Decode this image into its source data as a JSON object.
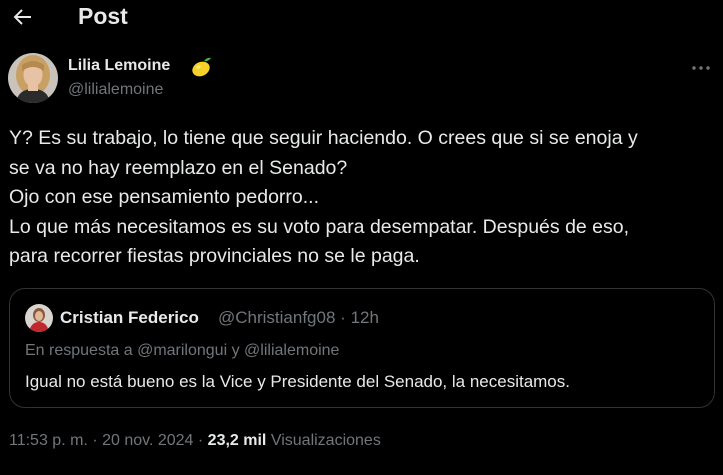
{
  "header": {
    "title": "Post",
    "back_icon": "arrow-left-icon"
  },
  "author": {
    "name": "Lilia Lemoine",
    "handle": "@lilialemoine",
    "badge_icon": "lemon-icon"
  },
  "post": {
    "lines": [
      "Y? Es su trabajo, lo tiene que seguir haciendo. O crees que si se enoja y",
      "se va no hay reemplazo en el Senado?",
      "Ojo con ese pensamiento pedorro...",
      "Lo que más necesitamos es su voto para desempatar. Después de eso,",
      "para recorrer fiestas provinciales no se le paga."
    ]
  },
  "quote": {
    "name": "Cristian Federico",
    "handle": "@Christianfg08",
    "time": "12h",
    "reply_prefix": "En respuesta a",
    "reply_user1": "@marilongui",
    "reply_and": "y",
    "reply_user2": "@lilialemoine",
    "text": "Igual no está bueno es la Vice y Presidente del Senado, la necesitamos."
  },
  "meta": {
    "time": "11:53 p. m.",
    "separator": "·",
    "date": "20 nov. 2024",
    "views_count": "23,2 mil",
    "views_label": "Visualizaciones"
  },
  "colors": {
    "background": "#000000",
    "text_primary": "#e7e9ea",
    "text_secondary": "#71767b",
    "border": "#2f3336"
  }
}
